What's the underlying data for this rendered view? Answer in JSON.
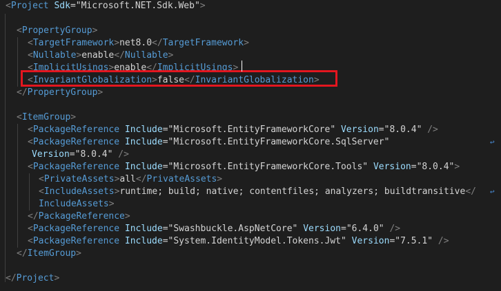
{
  "editor": {
    "lines": [
      {
        "indent": 0,
        "tokens": [
          [
            "br",
            "<"
          ],
          [
            "tag",
            "Project"
          ],
          [
            "sp",
            " "
          ],
          [
            "attr",
            "Sdk"
          ],
          [
            "eq",
            "="
          ],
          [
            "q",
            "\""
          ],
          [
            "val",
            "Microsoft.NET.Sdk.Web"
          ],
          [
            "q",
            "\""
          ],
          [
            "br",
            ">"
          ]
        ]
      },
      {
        "indent": 0,
        "tokens": []
      },
      {
        "indent": 1,
        "tokens": [
          [
            "br",
            "<"
          ],
          [
            "tag",
            "PropertyGroup"
          ],
          [
            "br",
            ">"
          ]
        ]
      },
      {
        "indent": 2,
        "tokens": [
          [
            "br",
            "<"
          ],
          [
            "tag",
            "TargetFramework"
          ],
          [
            "br",
            ">"
          ],
          [
            "text",
            "net8.0"
          ],
          [
            "br",
            "</"
          ],
          [
            "tag",
            "TargetFramework"
          ],
          [
            "br",
            ">"
          ]
        ]
      },
      {
        "indent": 2,
        "tokens": [
          [
            "br",
            "<"
          ],
          [
            "tag",
            "Nullable"
          ],
          [
            "br",
            ">"
          ],
          [
            "text",
            "enable"
          ],
          [
            "br",
            "</"
          ],
          [
            "tag",
            "Nullable"
          ],
          [
            "br",
            ">"
          ]
        ]
      },
      {
        "indent": 2,
        "tokens": [
          [
            "br",
            "<"
          ],
          [
            "tag",
            "ImplicitUsings"
          ],
          [
            "br",
            ">"
          ],
          [
            "text",
            "enable"
          ],
          [
            "br",
            "</"
          ],
          [
            "tag",
            "ImplicitUsings"
          ],
          [
            "br",
            ">"
          ]
        ]
      },
      {
        "indent": 2,
        "tokens": [
          [
            "br",
            "<"
          ],
          [
            "tag",
            "InvariantGlobalization"
          ],
          [
            "br",
            ">"
          ],
          [
            "text",
            "false"
          ],
          [
            "br",
            "</"
          ],
          [
            "tag",
            "InvariantGlobalization"
          ],
          [
            "br",
            ">"
          ]
        ]
      },
      {
        "indent": 1,
        "tokens": [
          [
            "br",
            "</"
          ],
          [
            "tag",
            "PropertyGroup"
          ],
          [
            "br",
            ">"
          ]
        ]
      },
      {
        "indent": 0,
        "tokens": []
      },
      {
        "indent": 1,
        "tokens": [
          [
            "br",
            "<"
          ],
          [
            "tag",
            "ItemGroup"
          ],
          [
            "br",
            ">"
          ]
        ]
      },
      {
        "indent": 2,
        "tokens": [
          [
            "br",
            "<"
          ],
          [
            "tag",
            "PackageReference"
          ],
          [
            "sp",
            " "
          ],
          [
            "attr",
            "Include"
          ],
          [
            "eq",
            "="
          ],
          [
            "q",
            "\""
          ],
          [
            "val",
            "Microsoft.EntityFrameworkCore"
          ],
          [
            "q",
            "\""
          ],
          [
            "sp",
            " "
          ],
          [
            "attr",
            "Version"
          ],
          [
            "eq",
            "="
          ],
          [
            "q",
            "\""
          ],
          [
            "val",
            "8.0.4"
          ],
          [
            "q",
            "\""
          ],
          [
            "sp",
            " "
          ],
          [
            "br",
            "/>"
          ]
        ]
      },
      {
        "indent": 2,
        "wrap": true,
        "tokens": [
          [
            "br",
            "<"
          ],
          [
            "tag",
            "PackageReference"
          ],
          [
            "sp",
            " "
          ],
          [
            "attr",
            "Include"
          ],
          [
            "eq",
            "="
          ],
          [
            "q",
            "\""
          ],
          [
            "val",
            "Microsoft.EntityFrameworkCore.SqlServer"
          ],
          [
            "q",
            "\""
          ]
        ]
      },
      {
        "indent": 2.4,
        "tokens": [
          [
            "attr",
            "Version"
          ],
          [
            "eq",
            "="
          ],
          [
            "q",
            "\""
          ],
          [
            "val",
            "8.0.4"
          ],
          [
            "q",
            "\""
          ],
          [
            "sp",
            " "
          ],
          [
            "br",
            "/>"
          ]
        ]
      },
      {
        "indent": 2,
        "tokens": [
          [
            "br",
            "<"
          ],
          [
            "tag",
            "PackageReference"
          ],
          [
            "sp",
            " "
          ],
          [
            "attr",
            "Include"
          ],
          [
            "eq",
            "="
          ],
          [
            "q",
            "\""
          ],
          [
            "val",
            "Microsoft.EntityFrameworkCore.Tools"
          ],
          [
            "q",
            "\""
          ],
          [
            "sp",
            " "
          ],
          [
            "attr",
            "Version"
          ],
          [
            "eq",
            "="
          ],
          [
            "q",
            "\""
          ],
          [
            "val",
            "8.0.4"
          ],
          [
            "q",
            "\""
          ],
          [
            "br",
            ">"
          ]
        ]
      },
      {
        "indent": 3,
        "tokens": [
          [
            "br",
            "<"
          ],
          [
            "tag",
            "PrivateAssets"
          ],
          [
            "br",
            ">"
          ],
          [
            "text",
            "all"
          ],
          [
            "br",
            "</"
          ],
          [
            "tag",
            "PrivateAssets"
          ],
          [
            "br",
            ">"
          ]
        ]
      },
      {
        "indent": 3,
        "wrap": true,
        "tokens": [
          [
            "br",
            "<"
          ],
          [
            "tag",
            "IncludeAssets"
          ],
          [
            "br",
            ">"
          ],
          [
            "text",
            "runtime; build; native; contentfiles; analyzers; buildtransitive"
          ],
          [
            "br",
            "</"
          ]
        ]
      },
      {
        "indent": 3,
        "tokens": [
          [
            "tag",
            "IncludeAssets"
          ],
          [
            "br",
            ">"
          ]
        ]
      },
      {
        "indent": 2,
        "tokens": [
          [
            "br",
            "</"
          ],
          [
            "tag",
            "PackageReference"
          ],
          [
            "br",
            ">"
          ]
        ]
      },
      {
        "indent": 2,
        "tokens": [
          [
            "br",
            "<"
          ],
          [
            "tag",
            "PackageReference"
          ],
          [
            "sp",
            " "
          ],
          [
            "attr",
            "Include"
          ],
          [
            "eq",
            "="
          ],
          [
            "q",
            "\""
          ],
          [
            "val",
            "Swashbuckle.AspNetCore"
          ],
          [
            "q",
            "\""
          ],
          [
            "sp",
            " "
          ],
          [
            "attr",
            "Version"
          ],
          [
            "eq",
            "="
          ],
          [
            "q",
            "\""
          ],
          [
            "val",
            "6.4.0"
          ],
          [
            "q",
            "\""
          ],
          [
            "sp",
            " "
          ],
          [
            "br",
            "/>"
          ]
        ]
      },
      {
        "indent": 2,
        "tokens": [
          [
            "br",
            "<"
          ],
          [
            "tag",
            "PackageReference"
          ],
          [
            "sp",
            " "
          ],
          [
            "attr",
            "Include"
          ],
          [
            "eq",
            "="
          ],
          [
            "q",
            "\""
          ],
          [
            "val",
            "System.IdentityModel.Tokens.Jwt"
          ],
          [
            "q",
            "\""
          ],
          [
            "sp",
            " "
          ],
          [
            "attr",
            "Version"
          ],
          [
            "eq",
            "="
          ],
          [
            "q",
            "\""
          ],
          [
            "val",
            "7.5.1"
          ],
          [
            "q",
            "\""
          ],
          [
            "sp",
            " "
          ],
          [
            "br",
            "/>"
          ]
        ]
      },
      {
        "indent": 1,
        "tokens": [
          [
            "br",
            "</"
          ],
          [
            "tag",
            "ItemGroup"
          ],
          [
            "br",
            ">"
          ]
        ]
      },
      {
        "indent": 0,
        "tokens": []
      },
      {
        "indent": 0,
        "tokens": [
          [
            "br",
            "</"
          ],
          [
            "tag",
            "Project"
          ],
          [
            "br",
            ">"
          ]
        ]
      }
    ],
    "highlight_color": "#e3161f",
    "wrap_icon": "word-wrap-icon"
  }
}
